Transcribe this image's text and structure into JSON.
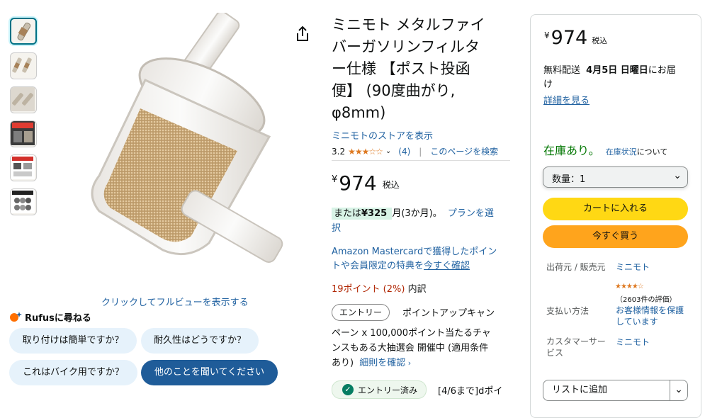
{
  "gallery": {
    "expand_text": "クリックしてフルビューを表示する"
  },
  "rufus": {
    "title": "Rufusに尋ねる",
    "chips": [
      "取り付けは簡単ですか？",
      "耐久性はどうですか？",
      "これはバイク用ですか？",
      "他のことを聞いてください"
    ]
  },
  "product": {
    "title": "ミニモト メタルファイバーガソリンフィルター仕様 【ポスト投函便】 (90度曲がり, φ8mm)",
    "title_lines": [
      "ミニモト メタルファイ",
      "バーガソリンフィルタ",
      "ー仕様 【ポスト投函",
      "便】 (90度曲がり,",
      "φ8mm)"
    ],
    "store_link": "ミニモトのストアを表示",
    "rating": "3.2",
    "stars": "★★★☆☆",
    "rating_count": "(4)",
    "search_page": "このページを検索",
    "currency": "¥",
    "price": "974",
    "tax": "税込",
    "installment_prefix": "または",
    "installment_amount": "¥325",
    "installment_suffix": "月(3か月)。",
    "installment_link": "プランを選",
    "installment_link2": "択",
    "mastercard_line1": "Amazon Mastercardで獲得したポイン",
    "mastercard_line2a": "トや会員限定の特典を",
    "mastercard_line2b": "今すぐ確認",
    "points_red": "19ポイント (2%)",
    "points_suffix": "内訳",
    "entry_button": "エントリー",
    "campaign_line1": "ポイントアップキャン",
    "campaign_line2": "ペーン x 100,000ポイント当たるチャ",
    "campaign_line3": "ンスもある大抽選会 開催中 (適用条件",
    "campaign_line4a": "あり)",
    "campaign_line4b": "細則を確認",
    "entry_done": "エントリー済み",
    "campaign2": "[4/6まで]dポイ"
  },
  "buybox": {
    "currency": "¥",
    "price": "974",
    "tax": "税込",
    "delivery_prefix": "無料配送",
    "delivery_date": "4月5日 日曜日",
    "delivery_suffix": "にお届",
    "delivery_suffix2": "け",
    "details_link": "詳細を見る",
    "stock": "在庫あり。",
    "stock_link": "在庫状況",
    "stock_suffix": "について",
    "qty_label": "数量：1",
    "add_to_cart": "カートに入れる",
    "buy_now": "今すぐ買う",
    "ships_label": "出荷元 / 販売元",
    "ships_value": "ミニモト",
    "seller_stars": "★★★★☆",
    "seller_ratings": "（2603件の評価）",
    "payment_label": "支払い方法",
    "payment_value1": "お客様情報を保護",
    "payment_value2": "しています",
    "cs_label1": "カスタマーサー",
    "cs_label2": "ビス",
    "cs_value": "ミニモト",
    "add_to_list": "リストに追加"
  },
  "colors": {
    "link": "#2162a1",
    "button_yellow": "#ffd814",
    "button_orange": "#ffa41c",
    "stock_green": "#007600",
    "points_red": "#b12704",
    "rufus_dark": "#1f5c99"
  }
}
